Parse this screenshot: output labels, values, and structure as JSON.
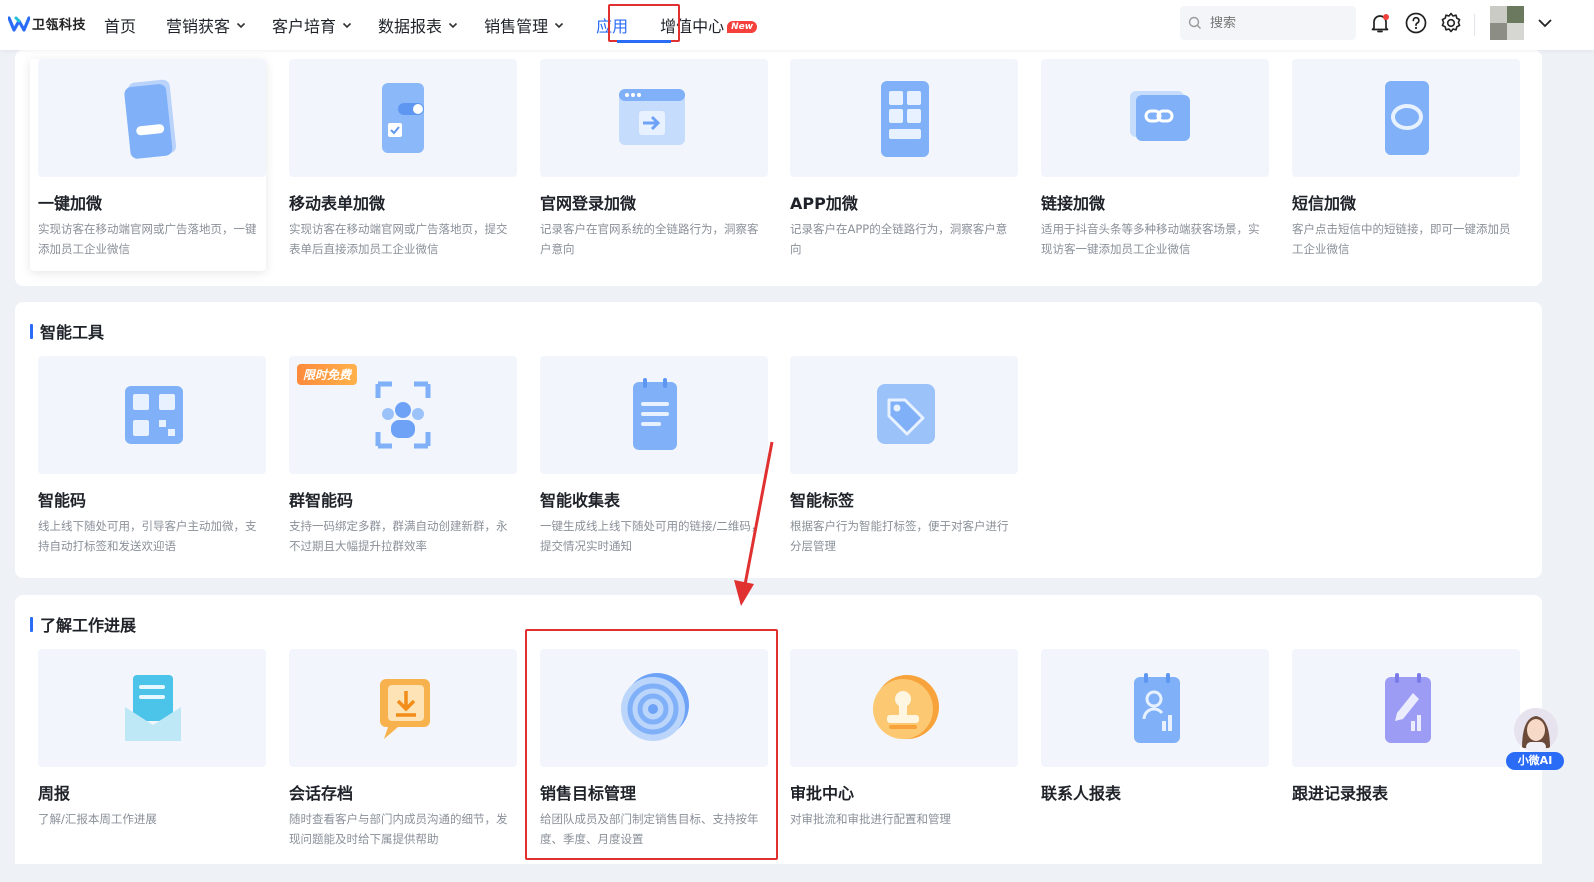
{
  "brand": {
    "name": "卫瓴科技"
  },
  "nav": {
    "items": [
      {
        "label": "首页",
        "dropdown": false
      },
      {
        "label": "营销获客",
        "dropdown": true
      },
      {
        "label": "客户培育",
        "dropdown": true
      },
      {
        "label": "数据报表",
        "dropdown": true
      },
      {
        "label": "销售管理",
        "dropdown": true
      },
      {
        "label": "应用",
        "dropdown": false,
        "active": true
      },
      {
        "label": "增值中心",
        "dropdown": false,
        "badge": "New"
      }
    ]
  },
  "search": {
    "placeholder": "搜索"
  },
  "header_icons": [
    "bell-icon",
    "help-icon",
    "gear-icon",
    "chevron-down-icon"
  ],
  "sections": {
    "acquire": {
      "cards": [
        {
          "title": "一键加微",
          "desc": "实现访客在移动端官网或广告落地页，一键添加员工企业微信",
          "icon": "phone-button-icon"
        },
        {
          "title": "移动表单加微",
          "desc": "实现访客在移动端官网或广告落地页，提交表单后直接添加员工企业微信",
          "icon": "phone-form-icon"
        },
        {
          "title": "官网登录加微",
          "desc": "记录客户在官网系统的全链路行为，洞察客户意向",
          "icon": "browser-login-icon"
        },
        {
          "title": "APP加微",
          "desc": "记录客户在APP的全链路行为，洞察客户意向",
          "icon": "app-grid-icon"
        },
        {
          "title": "链接加微",
          "desc": "适用于抖音头条等多种移动端获客场景，实现访客一键添加员工企业微信",
          "icon": "link-chat-icon"
        },
        {
          "title": "短信加微",
          "desc": "客户点击短信中的短链接，即可一键添加员工企业微信",
          "icon": "sms-icon"
        }
      ]
    },
    "tools": {
      "title": "智能工具",
      "cards": [
        {
          "title": "智能码",
          "desc": "线上线下随处可用，引导客户主动加微，支持自动打标签和发送欢迎语",
          "icon": "qr-code-icon"
        },
        {
          "title": "群智能码",
          "desc": "支持一码绑定多群，群满自动创建新群，永不过期且大幅提升拉群效率",
          "icon": "group-qr-icon",
          "tag": "限时免费"
        },
        {
          "title": "智能收集表",
          "desc": "一键生成线上线下随处可用的链接/二维码，提交情况实时通知",
          "icon": "form-clipboard-icon"
        },
        {
          "title": "智能标签",
          "desc": "根据客户行为智能打标签，便于对客户进行分层管理",
          "icon": "tag-icon"
        }
      ]
    },
    "progress": {
      "title": "了解工作进展",
      "cards": [
        {
          "title": "周报",
          "desc": "了解/汇报本周工作进展",
          "icon": "report-envelope-icon"
        },
        {
          "title": "会话存档",
          "desc": "随时查看客户与部门内成员沟通的细节，发现问题能及时给下属提供帮助",
          "icon": "chat-archive-icon"
        },
        {
          "title": "销售目标管理",
          "desc": "给团队成员及部门制定销售目标、支持按年度、季度、月度设置",
          "icon": "target-icon"
        },
        {
          "title": "审批中心",
          "desc": "对审批流和审批进行配置和管理",
          "icon": "stamp-icon"
        },
        {
          "title": "联系人报表",
          "desc": "",
          "icon": "contact-report-icon"
        },
        {
          "title": "跟进记录报表",
          "desc": "",
          "icon": "followup-report-icon"
        }
      ]
    }
  },
  "ai_assistant": {
    "label": "小微AI"
  },
  "colors": {
    "accent": "#2b6cf6",
    "highlight": "#e03030",
    "icon_blue": "#6ea2f7",
    "icon_orange": "#f7a23a"
  }
}
